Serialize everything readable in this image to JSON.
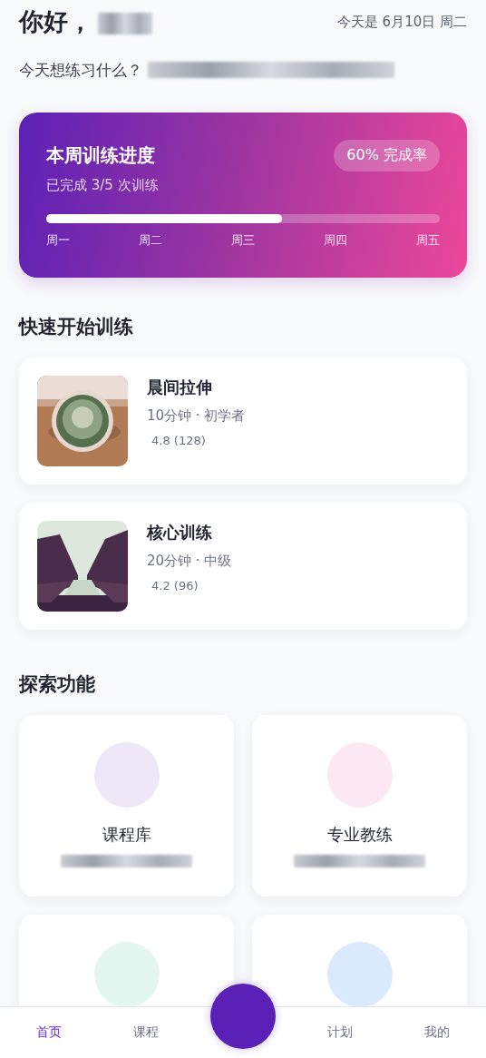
{
  "header": {
    "greeting": "你好，",
    "date": "今天是 6月10日 周二",
    "prompt": "今天想练习什么？"
  },
  "progress": {
    "title": "本周训练进度",
    "badge": "60% 完成率",
    "subtitle": "已完成 3/5 次训练",
    "level": 0.6,
    "days": [
      "周一",
      "周二",
      "周三",
      "周四",
      "周五"
    ]
  },
  "quick_start": {
    "title": "快速开始训练",
    "workouts": [
      {
        "title": "晨间拉伸",
        "meta": "10分钟 · 初学者",
        "rating": "4.8 (128)",
        "kind": "picture"
      },
      {
        "title": "核心训练",
        "meta": "20分钟 · 中级",
        "rating": "4.2 (96)",
        "kind": "picture"
      }
    ]
  },
  "explore": {
    "title": "探索功能",
    "features": [
      {
        "title": "课程库",
        "color": "#ede7f8"
      },
      {
        "title": "专业教练",
        "color": "#fce8f3"
      },
      {
        "color": "#e3f6ef"
      },
      {
        "color": "#dbe9fd"
      }
    ]
  },
  "nav": {
    "items": [
      {
        "label": "首页",
        "selected": true
      },
      {
        "label": "课程",
        "selected": false
      },
      {
        "kind": "center"
      },
      {
        "label": "计划",
        "selected": false
      },
      {
        "label": "我的",
        "selected": false
      }
    ]
  }
}
